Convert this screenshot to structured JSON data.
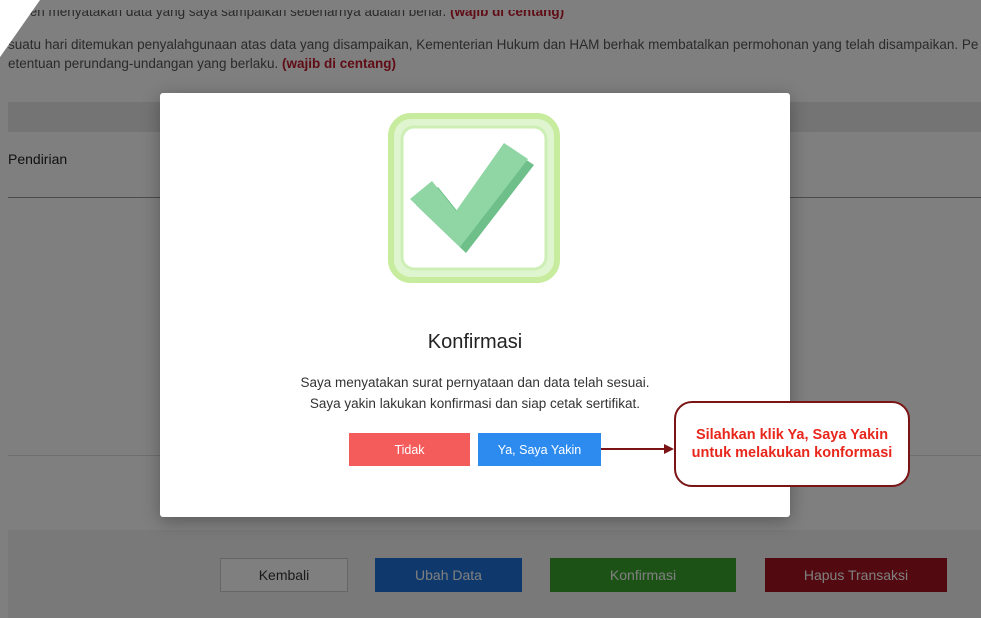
{
  "background": {
    "line1": "lemen menyatakan data yang saya sampaikan sebenarnya adalah benar.",
    "line1_req": "(wajib di centang)",
    "line2": "suatu hari ditemukan penyalahgunaan atas data yang disampaikan, Kementerian Hukum dan HAM berhak membatalkan permohonan yang telah disampaikan. Pe",
    "line3": "etentuan perundang-undangan yang berlaku.",
    "line3_req": "(wajib di centang)",
    "section_label": "Pendirian"
  },
  "bottom_buttons": {
    "kembali": "Kembali",
    "ubah_data": "Ubah Data",
    "konfirmasi": "Konfirmasi",
    "hapus_transaksi": "Hapus Transaksi"
  },
  "modal": {
    "title": "Konfirmasi",
    "message_line1": "Saya menyatakan surat pernyataan dan data telah sesuai.",
    "message_line2": "Saya yakin lakukan konfirmasi dan siap cetak sertifikat.",
    "cancel_label": "Tidak",
    "confirm_label": "Ya, Saya Yakin"
  },
  "callout": {
    "line1": "Silahkan klik Ya, Saya Yakin",
    "line2": "untuk melakukan konformasi"
  },
  "icons": {
    "modal_icon": "check-icon"
  },
  "colors": {
    "cancel": "#f45b5b",
    "confirm": "#2d8bf0",
    "check_green": "#7fcf97",
    "callout_text": "#e8261b",
    "callout_border": "#7b1414"
  }
}
